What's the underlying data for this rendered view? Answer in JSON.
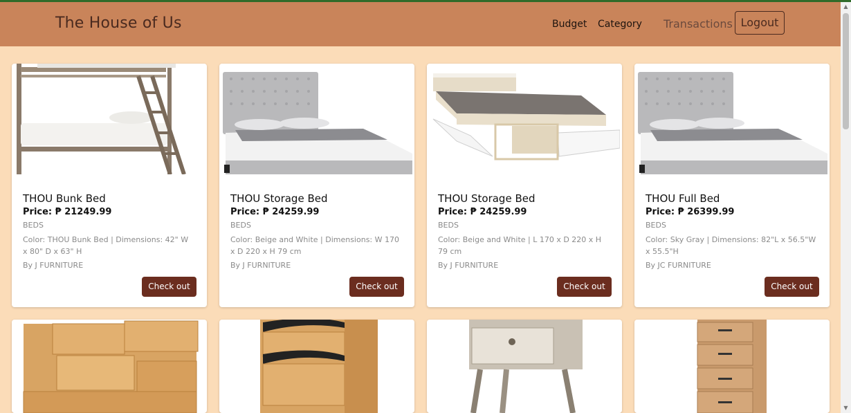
{
  "navbar": {
    "brand": "The House of Us",
    "links": {
      "budget": "Budget",
      "category": "Category",
      "transactions": "Transactions"
    },
    "logout_label": "Logout"
  },
  "products": [
    {
      "title": "THOU Bunk Bed",
      "price": "Price: ₱ 21249.99",
      "category": "BEDS",
      "description": "Color: THOU Bunk Bed | Dimensions: 42\" W x 80\" D x 63\" H",
      "brand": "By J FURNITURE",
      "button": "Check out"
    },
    {
      "title": "THOU Storage Bed",
      "price": "Price: ₱ 24259.99",
      "category": "BEDS",
      "description": "Color: Beige and White | Dimensions: W 170 x D 220 x H 79 cm",
      "brand": "By J FURNITURE",
      "button": "Check out"
    },
    {
      "title": "THOU Storage Bed",
      "price": "Price: ₱ 24259.99",
      "category": "BEDS",
      "description": "Color: Beige and White | L 170 x D 220 x H 79 cm",
      "brand": "By J FURNITURE",
      "button": "Check out"
    },
    {
      "title": "THOU Full Bed",
      "price": "Price: ₱ 26399.99",
      "category": "BEDS",
      "description": "Color: Sky Gray | Dimensions: 82\"L x 56.5\"W x 55.5\"H",
      "brand": "By JC FURNITURE",
      "button": "Check out"
    }
  ],
  "colors": {
    "page_bg": "#fbdcb8",
    "navbar_bg": "#c9845a",
    "button_bg": "#6b2d1f",
    "accent_line": "#2f6b2a"
  }
}
